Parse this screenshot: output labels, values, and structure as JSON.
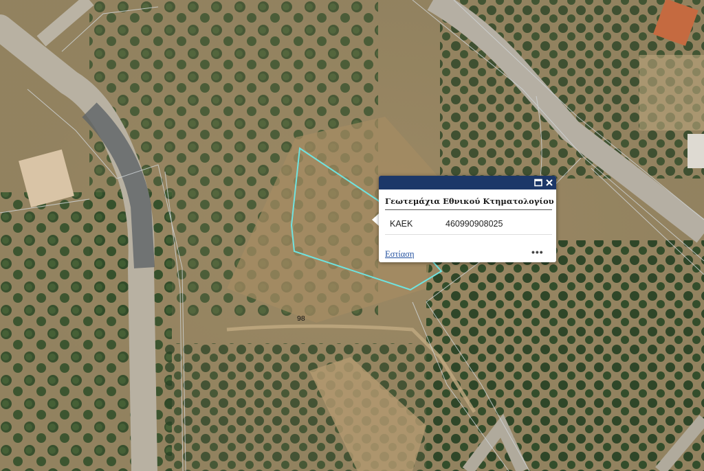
{
  "popup": {
    "title": "Γεωτεμάχια Εθνικού Κτηματολογίου",
    "field_name": "ΚΑΕΚ",
    "field_value": "460990908025",
    "zoom_link": "Εστίαση",
    "more_label": "•••",
    "header_color": "#1c3768"
  },
  "map": {
    "parcel_number": "98",
    "highlight_color": "#6fe3e0"
  }
}
